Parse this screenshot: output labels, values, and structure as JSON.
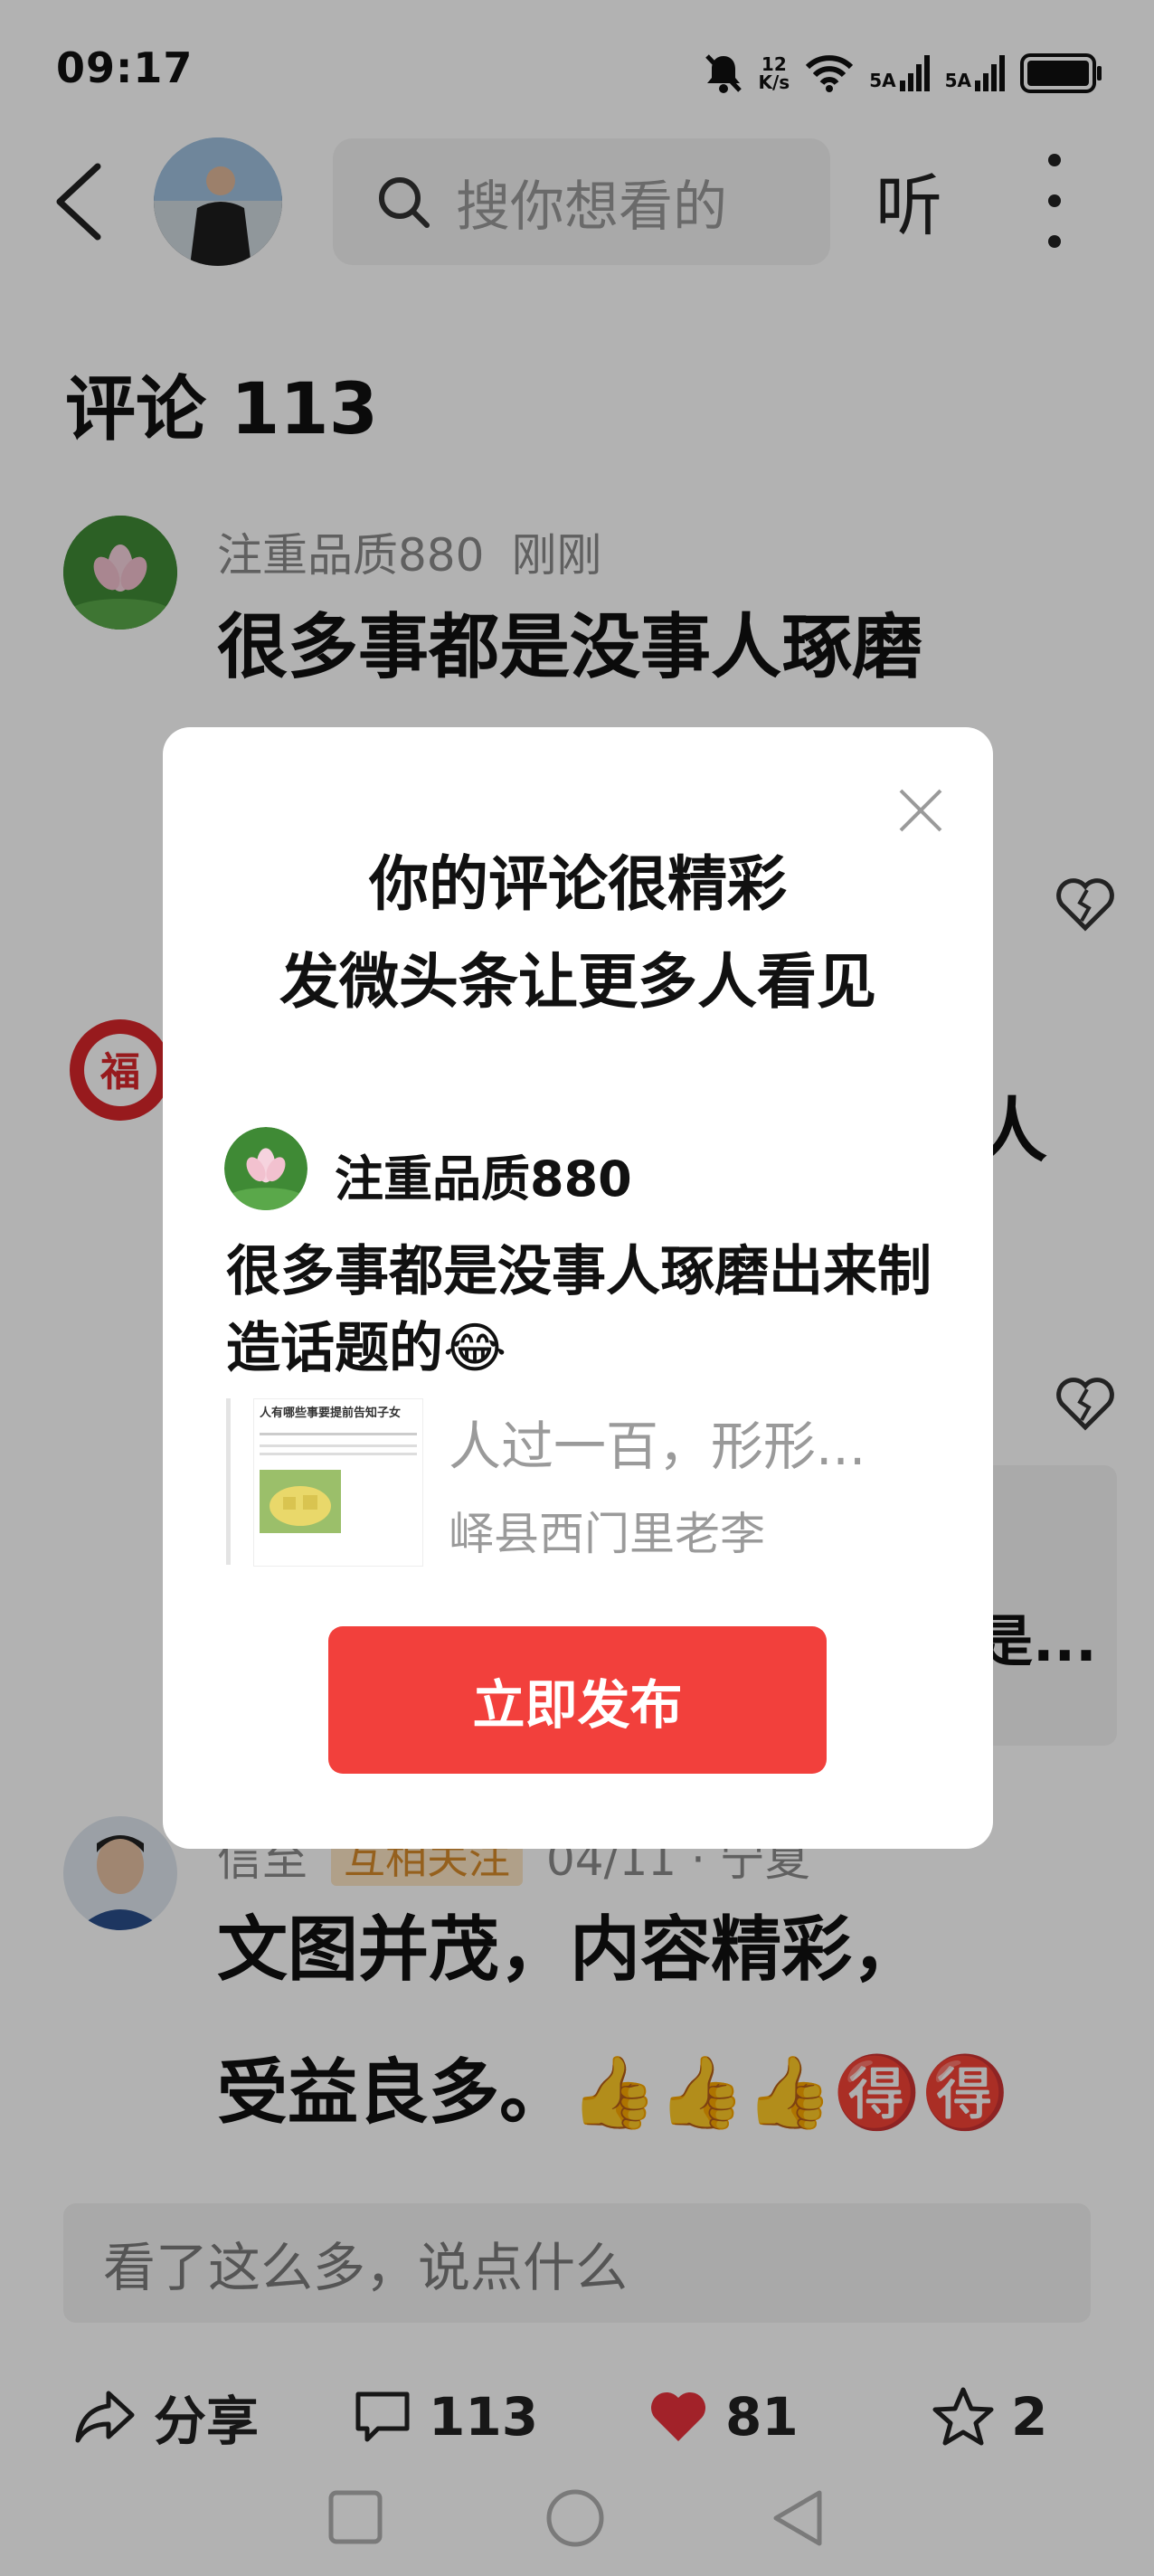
{
  "status_bar": {
    "time": "09:17",
    "net_speed_value": "12",
    "net_speed_unit": "K/s",
    "sim1": "5A",
    "sim2": "5A"
  },
  "header": {
    "search_placeholder": "搜你想看的",
    "listen_label": "听"
  },
  "comments": {
    "title": "评论 113",
    "items": [
      {
        "name": "注重品质880",
        "time": "刚刚",
        "text": "很多事都是没事人琢磨"
      },
      {
        "name": "信至",
        "badge": "互相关注",
        "meta": "04/11 · 宁夏",
        "text": "文图并茂，内容精彩，",
        "text2": "受益良多。👍👍👍🉐🉐"
      }
    ],
    "partial_text": "人",
    "partial_text2": "是..."
  },
  "modal": {
    "title_line1": "你的评论很精彩",
    "title_line2": "发微头条让更多人看见",
    "user_name": "注重品质880",
    "comment_text": "很多事都是没事人琢磨出来制造话题的😂",
    "quote_title": "人过一百，形形...",
    "quote_author": "峄县西门里老李",
    "thumb_caption": "人有哪些事要提前告知子女",
    "publish_label": "立即发布"
  },
  "bottom": {
    "input_placeholder": "看了这么多，说点什么",
    "share_label": "分享",
    "comment_count": "113",
    "like_count": "81",
    "fav_count": "2"
  },
  "colors": {
    "accent_red": "#f2403c",
    "like_red": "#e8323c",
    "badge_bg": "#fde6c4",
    "badge_text": "#d68a2a"
  }
}
